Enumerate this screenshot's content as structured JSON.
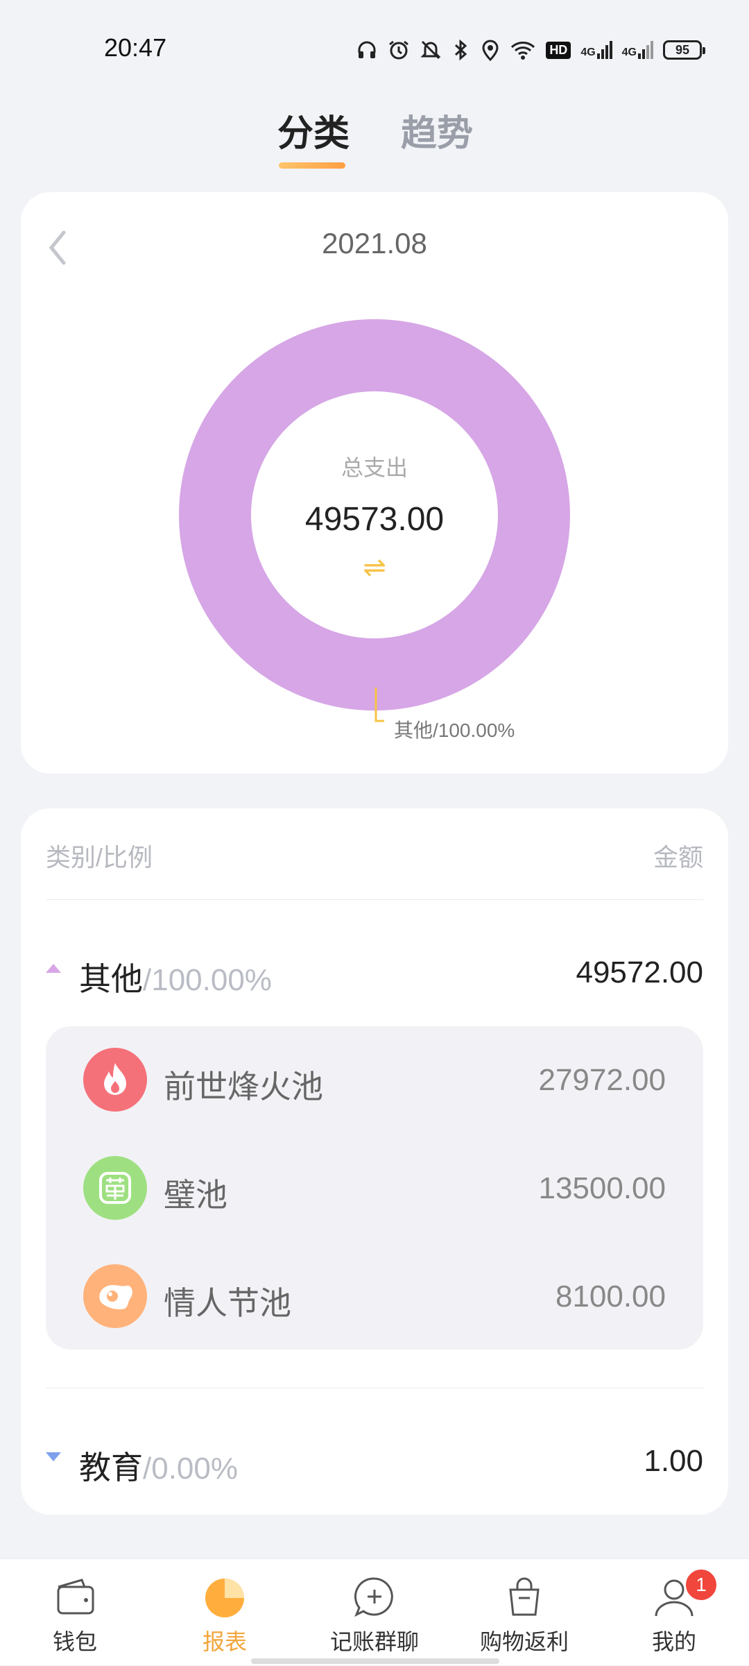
{
  "status_bar": {
    "time": "20:47",
    "battery": "95",
    "hd_label": "HD",
    "net_label_1": "4G",
    "net_label_2": "4G"
  },
  "tabs": [
    {
      "label": "分类"
    },
    {
      "label": "趋势"
    }
  ],
  "chart_card": {
    "month": "2021.08",
    "total_title": "总支出",
    "total_value": "49573.00",
    "swap_symbol": "⇌",
    "slice_label": "其他/100.00%"
  },
  "chart_data": {
    "type": "pie",
    "categories": [
      "其他",
      "教育"
    ],
    "values": [
      49572.0,
      1.0
    ],
    "percent_labels": [
      "100.00%",
      "0.00%"
    ],
    "colors": [
      "#d6a6e6",
      "#7ea1ee"
    ]
  },
  "list": {
    "header_left": "类别/比例",
    "header_right": "金额",
    "categories": [
      {
        "name": "其他",
        "pct": "/100.00%",
        "amount": "49572.00",
        "expanded": true,
        "items": [
          {
            "name": "前世烽火池",
            "amount": "27972.00",
            "icon": "fire-icon",
            "color": "#f5717a"
          },
          {
            "name": "璧池",
            "amount": "13500.00",
            "icon": "wan-character-icon",
            "color": "#9ee081"
          },
          {
            "name": "情人节池",
            "amount": "8100.00",
            "icon": "egg-icon",
            "color": "#ffb27a"
          }
        ]
      },
      {
        "name": "教育",
        "pct": "/0.00%",
        "amount": "1.00",
        "expanded": false,
        "items": []
      }
    ]
  },
  "bottom_nav": [
    {
      "label": "钱包",
      "icon": "wallet-icon"
    },
    {
      "label": "报表",
      "icon": "report-icon",
      "active": true
    },
    {
      "label": "记账群聊",
      "icon": "chat-add-icon"
    },
    {
      "label": "购物返利",
      "icon": "shopping-bag-icon"
    },
    {
      "label": "我的",
      "icon": "user-icon",
      "badge": "1"
    }
  ]
}
